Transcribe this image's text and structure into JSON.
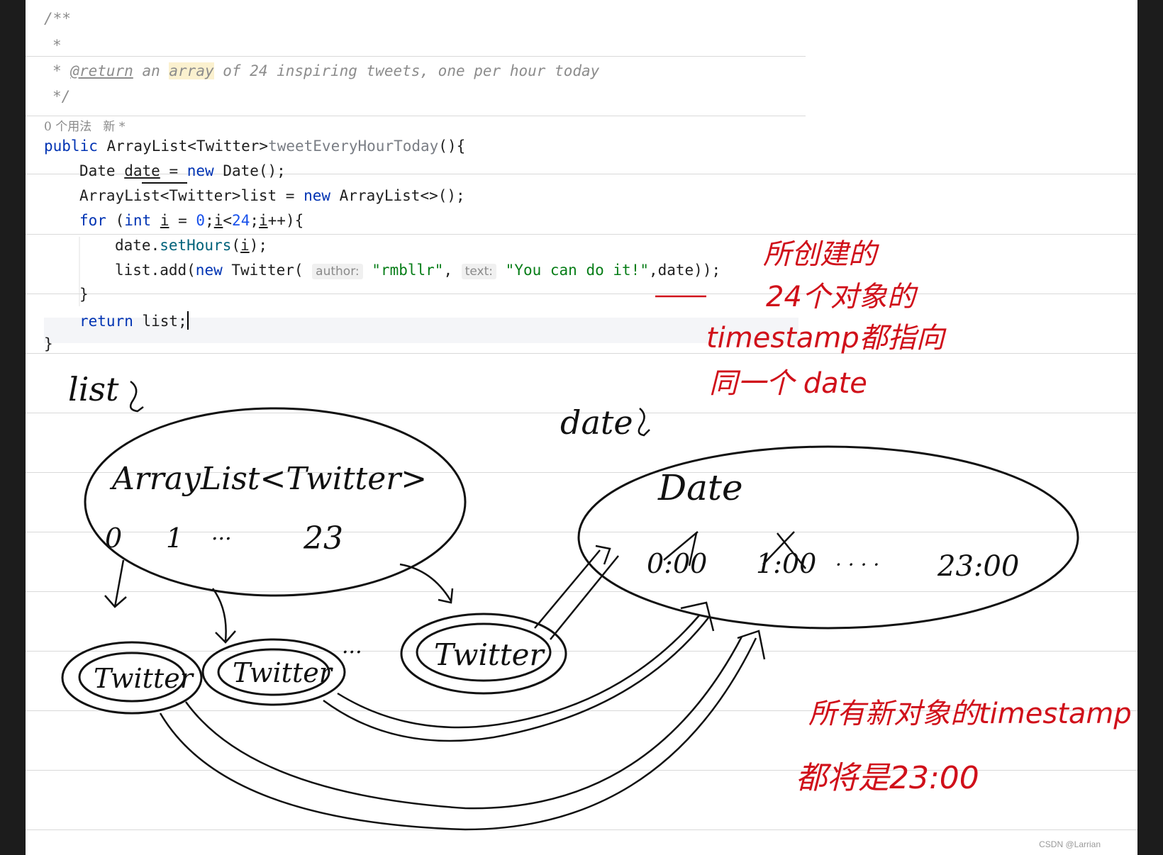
{
  "code": {
    "doc_open": "/**",
    "doc_star": "*",
    "doc_return_prefix": "* ",
    "doc_return_tag": "@return",
    "doc_an": " an ",
    "doc_array": "array",
    "doc_rest": " of 24 inspiring tweets, one per hour today",
    "doc_close": "*/",
    "usage_hint": "0 个用法   新 *",
    "kw_public": "public",
    "sig_type": " ArrayList<Twitter>",
    "sig_method": "tweetEveryHourToday",
    "sig_end": "(){",
    "l1_type": "Date ",
    "l1_var": "date",
    "l1_eq": " = ",
    "kw_new": "new",
    "l1_end": " Date();",
    "l2_start": "ArrayList<Twitter>list = ",
    "l2_end": " ArrayList<>();",
    "kw_for": "for",
    "l3_paren": " (",
    "kw_int": "int",
    "l3_i": "i",
    "l3_eq": " = ",
    "l3_zero": "0",
    "l3_semi": ";",
    "l3_i2": "i",
    "l3_lt": "<",
    "l3_24": "24",
    "l3_semi2": ";",
    "l3_i3": "i",
    "l3_end": "++){",
    "l4_date": "date.",
    "l4_call": "setHours",
    "l4_open": "(",
    "l4_i": "i",
    "l4_end": ");",
    "l5_start": "list.add(",
    "l5_twitter": " Twitter( ",
    "hint_author": "author:",
    "str_author": "\"rmbllr\"",
    "l5_comma": ", ",
    "hint_text": "text:",
    "str_text": "\"You can do it!\"",
    "l5_end": ",date));",
    "close_inner": "}",
    "kw_return": "return",
    "return_rest": " list;",
    "close_outer": "}"
  },
  "notes": {
    "list_label": "list",
    "date_label": "date",
    "arraylist_label": "ArrayList<Twitter>",
    "index_0": "0",
    "index_1": "1",
    "index_dots": "···",
    "index_23": "23",
    "date_object": "Date",
    "time_0": "0:00",
    "time_1": "1:00",
    "time_dots": "· · · ·",
    "time_23": "23:00",
    "twitter_1": "Twitter",
    "twitter_2": "Twitter",
    "twitter_dots": "···",
    "twitter_3": "Twitter",
    "red_note_1_line1": "所创建的",
    "red_note_1_line2": "24个对象的",
    "red_note_1_line3": "timestamp都指向",
    "red_note_1_line4": "同一个 date",
    "red_note_2_line1": "所有新对象的timestamp",
    "red_note_2_line2": "都将是23:00"
  },
  "watermark": "CSDN @Larrian",
  "colors": {
    "keyword": "#0033b3",
    "string": "#067d17",
    "method": "#00627a",
    "number": "#1750eb",
    "comment": "#8c8c8c",
    "ink_red": "#d0101a",
    "ink_black": "#111111"
  }
}
